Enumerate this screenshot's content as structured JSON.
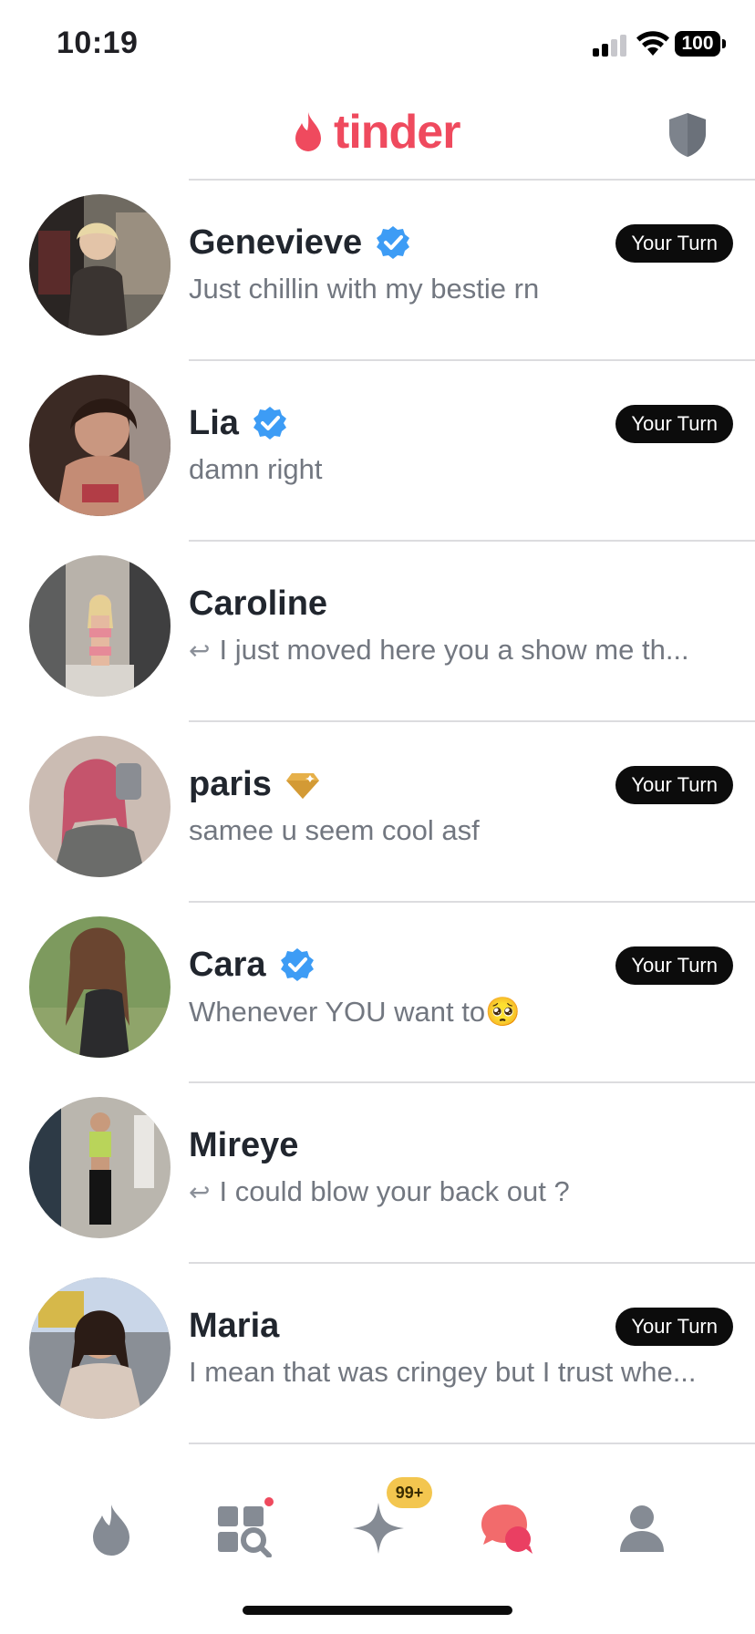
{
  "status_bar": {
    "time": "10:19",
    "battery": "100",
    "icons": [
      "signal-icon",
      "wifi-icon",
      "battery-icon"
    ]
  },
  "header": {
    "logo_text": "tinder",
    "brand_color": "#ef4a5e",
    "icons": [
      "flame-logo-icon",
      "shield-safety-icon"
    ]
  },
  "conversations": [
    {
      "name": "Genevieve",
      "badge": "verified-icon",
      "message": "Just chillin with my bestie rn",
      "replied": false,
      "your_turn": "Your Turn"
    },
    {
      "name": "Lia",
      "badge": "verified-icon",
      "message": "damn right",
      "replied": false,
      "your_turn": "Your Turn"
    },
    {
      "name": "Caroline",
      "badge": "",
      "message": "I just moved here you a show me th...",
      "replied": true,
      "your_turn": ""
    },
    {
      "name": "paris",
      "badge": "gold-diamond-icon",
      "message": "samee u seem cool asf",
      "replied": false,
      "your_turn": "Your Turn"
    },
    {
      "name": "Cara",
      "badge": "verified-icon",
      "message": "Whenever YOU want to🥺",
      "replied": false,
      "your_turn": "Your Turn"
    },
    {
      "name": "Mireye",
      "badge": "",
      "message": "I could blow your back out ?",
      "replied": true,
      "your_turn": ""
    },
    {
      "name": "Maria",
      "badge": "",
      "message": "I mean that was cringey but I trust whe...",
      "replied": false,
      "your_turn": "Your Turn"
    }
  ],
  "tab_bar": {
    "tabs": [
      "flame-tab-icon",
      "explore-tab-icon",
      "spark-tab-icon",
      "chat-tab-icon",
      "profile-tab-icon"
    ],
    "active": "chat-tab-icon",
    "spark_badge": "99+",
    "colors": {
      "inactive": "#858b94",
      "active": "#ef4a5e",
      "badge": "#f3c64f"
    }
  }
}
